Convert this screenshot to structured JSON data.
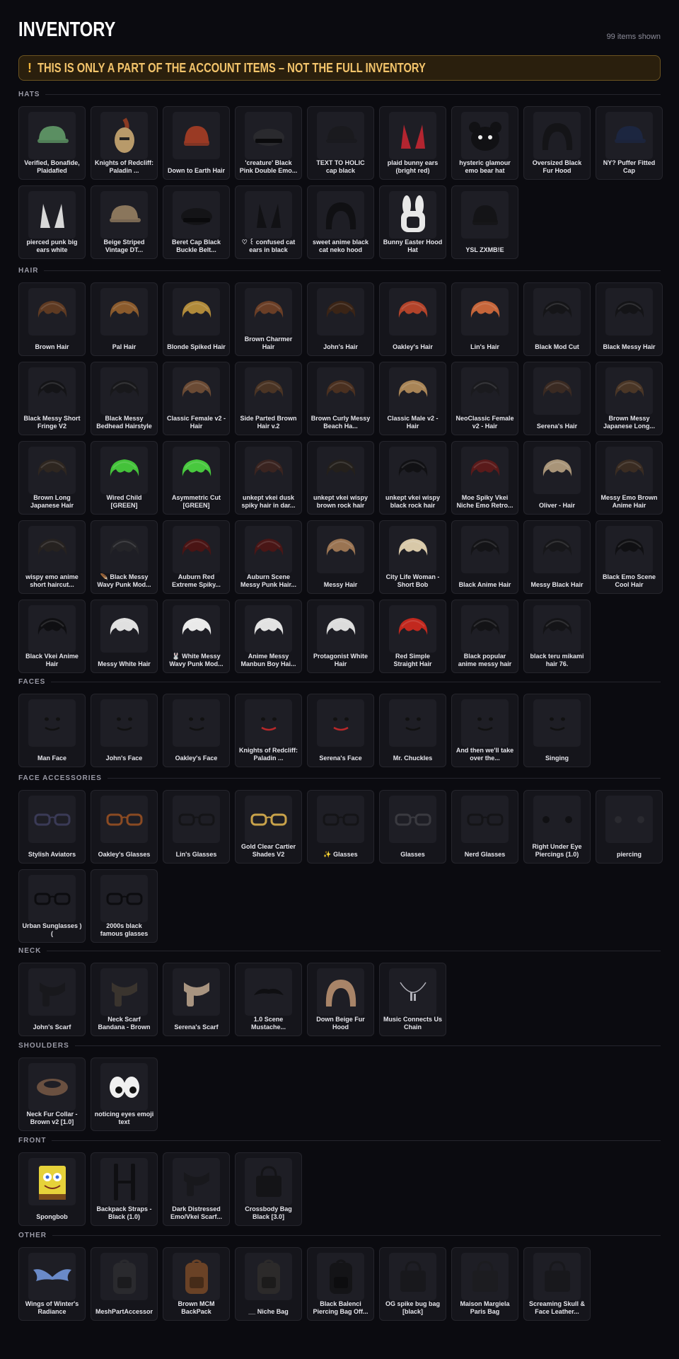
{
  "header": {
    "title": "INVENTORY",
    "count": "99 items shown"
  },
  "notice": {
    "icon": "!",
    "text": "THIS IS ONLY A PART OF THE ACCOUNT ITEMS – NOT THE FULL INVENTORY"
  },
  "sections": [
    {
      "title": "HATS",
      "items": [
        {
          "name": "Verified, Bonafide, Plaidafied",
          "icon": "cap-icon",
          "color": "#5b8f62"
        },
        {
          "name": "Knights of Redcliff: Paladin ...",
          "icon": "helmet-icon",
          "color": "#8a3a22"
        },
        {
          "name": "Down to Earth Hair",
          "icon": "beanie-icon",
          "color": "#9a3a24"
        },
        {
          "name": "'creature' Black Pink Double Emo...",
          "icon": "hat-icon",
          "color": "#2a2a2e"
        },
        {
          "name": "TEXT TO HOLIC cap black",
          "icon": "cap-icon",
          "color": "#1a1a1e"
        },
        {
          "name": "plaid bunny ears (bright red)",
          "icon": "ears-icon",
          "color": "#b32530"
        },
        {
          "name": "hysteric glamour emo bear hat",
          "icon": "bear-hat-icon",
          "color": "#111114"
        },
        {
          "name": "Oversized Black Fur Hood",
          "icon": "hood-icon",
          "color": "#141417"
        },
        {
          "name": "NY? Puffer Fitted Cap",
          "icon": "cap-icon",
          "color": "#1c2640"
        },
        {
          "name": "pierced punk big ears white",
          "icon": "ears-icon",
          "color": "#d8d8d8"
        },
        {
          "name": "Beige Striped Vintage DT...",
          "icon": "cap-icon",
          "color": "#8a765c"
        },
        {
          "name": "Beret Cap Black Buckle Belt...",
          "icon": "beret-icon",
          "color": "#141417"
        },
        {
          "name": "♡ ꒰ confused cat ears in black",
          "icon": "cat-ears-icon",
          "color": "#111114"
        },
        {
          "name": "sweet anime black cat neko hood",
          "icon": "hood-icon",
          "color": "#101013"
        },
        {
          "name": "Bunny Easter Hood Hat",
          "icon": "bunny-hood-icon",
          "color": "#e8e8e8"
        },
        {
          "name": "YSL ZXMB!E",
          "icon": "beanie-icon",
          "color": "#141417"
        }
      ]
    },
    {
      "title": "HAIR",
      "items": [
        {
          "name": "Brown Hair",
          "icon": "hair-icon",
          "color": "#5e3a22"
        },
        {
          "name": "Pal Hair",
          "icon": "hair-icon",
          "color": "#8a5a2c"
        },
        {
          "name": "Blonde Spiked Hair",
          "icon": "hair-icon",
          "color": "#b08a3a"
        },
        {
          "name": "Brown Charmer Hair",
          "icon": "hair-icon",
          "color": "#6a3e26"
        },
        {
          "name": "John's Hair",
          "icon": "hair-icon",
          "color": "#3a2416"
        },
        {
          "name": "Oakley's Hair",
          "icon": "hair-icon",
          "color": "#b2432a"
        },
        {
          "name": "Lin's Hair",
          "icon": "hair-icon",
          "color": "#c5653a"
        },
        {
          "name": "Black Mod Cut",
          "icon": "hair-icon",
          "color": "#151518"
        },
        {
          "name": "Black Messy Hair",
          "icon": "hair-icon",
          "color": "#141417"
        },
        {
          "name": "Black Messy Short Fringe V2",
          "icon": "hair-icon",
          "color": "#141417"
        },
        {
          "name": "Black Messy Bedhead Hairstyle",
          "icon": "hair-icon",
          "color": "#18181b"
        },
        {
          "name": "Classic Female v2 - Hair",
          "icon": "hair-icon",
          "color": "#6a4a34"
        },
        {
          "name": "Side Parted Brown Hair v.2",
          "icon": "hair-icon",
          "color": "#4a3424"
        },
        {
          "name": "Brown Curly Messy Beach Ha...",
          "icon": "hair-icon",
          "color": "#4a3020"
        },
        {
          "name": "Classic Male v2 - Hair",
          "icon": "hair-icon",
          "color": "#a88456"
        },
        {
          "name": "NeoClassic Female v2 - Hair",
          "icon": "hair-icon",
          "color": "#1a1a1e"
        },
        {
          "name": "Serena's Hair",
          "icon": "hair-icon",
          "color": "#3a2a22"
        },
        {
          "name": "Brown Messy Japanese Long...",
          "icon": "hair-icon",
          "color": "#4a3626"
        },
        {
          "name": "Brown Long Japanese Hair",
          "icon": "hair-icon",
          "color": "#2e2620"
        },
        {
          "name": "Wired Child [GREEN]",
          "icon": "hair-icon",
          "color": "#44c23a"
        },
        {
          "name": "Asymmetric Cut [GREEN]",
          "icon": "hair-icon",
          "color": "#48c83e"
        },
        {
          "name": "unkept vkei dusk spiky hair in dar...",
          "icon": "hair-icon",
          "color": "#3a2420"
        },
        {
          "name": "unkept vkei wispy brown rock hair",
          "icon": "hair-icon",
          "color": "#24201c"
        },
        {
          "name": "unkept vkei wispy black rock hair",
          "icon": "hair-icon",
          "color": "#111114"
        },
        {
          "name": "Moe Spiky Vkei Niche Emo Retro...",
          "icon": "hair-icon",
          "color": "#5a1a1a"
        },
        {
          "name": "Oliver - Hair",
          "icon": "hair-icon",
          "color": "#a89478"
        },
        {
          "name": "Messy Emo Brown Anime Hair",
          "icon": "hair-icon",
          "color": "#3a2c22"
        },
        {
          "name": "wispy emo anime short haircut...",
          "icon": "hair-icon",
          "color": "#262220"
        },
        {
          "name": "🪶 Black Messy Wavy Punk Mod...",
          "icon": "hair-icon",
          "color": "#242428"
        },
        {
          "name": "Auburn Red Extreme Spiky...",
          "icon": "hair-icon",
          "color": "#4a1414"
        },
        {
          "name": "Auburn Scene Messy Punk Hair...",
          "icon": "hair-icon",
          "color": "#4a1616"
        },
        {
          "name": "Messy Hair",
          "icon": "hair-icon",
          "color": "#9a7452"
        },
        {
          "name": "City Life Woman - Short Bob",
          "icon": "hair-icon",
          "color": "#d8c8a8"
        },
        {
          "name": "Black Anime Hair",
          "icon": "hair-icon",
          "color": "#141417"
        },
        {
          "name": "Messy Black Hair",
          "icon": "hair-icon",
          "color": "#17171a"
        },
        {
          "name": "Black Emo Scene Cool Hair",
          "icon": "hair-icon",
          "color": "#101013"
        },
        {
          "name": "Black Vkei Anime Hair",
          "icon": "hair-icon",
          "color": "#0f0f12"
        },
        {
          "name": "Messy White Hair",
          "icon": "hair-icon",
          "color": "#e0e0e0"
        },
        {
          "name": "🐰 White Messy Wavy Punk Mod...",
          "icon": "hair-icon",
          "color": "#eaeaea"
        },
        {
          "name": "Anime Messy Manbun Boy Hai...",
          "icon": "hair-icon",
          "color": "#e2e2e2"
        },
        {
          "name": "Protagonist White Hair",
          "icon": "hair-icon",
          "color": "#dcdcdc"
        },
        {
          "name": "Red Simple Straight Hair",
          "icon": "hair-icon",
          "color": "#c2281e"
        },
        {
          "name": "Black popular anime messy hair",
          "icon": "hair-icon",
          "color": "#131316"
        },
        {
          "name": "black teru mikami hair 76.",
          "icon": "hair-icon",
          "color": "#141417"
        }
      ]
    },
    {
      "title": "FACES",
      "items": [
        {
          "name": "Man Face",
          "icon": "face-icon",
          "color": "#111"
        },
        {
          "name": "John's Face",
          "icon": "face-icon",
          "color": "#111"
        },
        {
          "name": "Oakley's Face",
          "icon": "face-icon",
          "color": "#111"
        },
        {
          "name": "Knights of Redcliff: Paladin ...",
          "icon": "face-icon",
          "color": "#b8282a"
        },
        {
          "name": "Serena's Face",
          "icon": "face-icon",
          "color": "#b8282a"
        },
        {
          "name": "Mr. Chuckles",
          "icon": "face-icon",
          "color": "#111"
        },
        {
          "name": "And then we'll take over the...",
          "icon": "face-icon",
          "color": "#111"
        },
        {
          "name": "Singing",
          "icon": "face-icon",
          "color": "#111"
        }
      ]
    },
    {
      "title": "FACE ACCESSORIES",
      "items": [
        {
          "name": "Stylish Aviators",
          "icon": "glasses-icon",
          "color": "#3a3a56"
        },
        {
          "name": "Oakley's Glasses",
          "icon": "glasses-icon",
          "color": "#8a4a22"
        },
        {
          "name": "Lin's Glasses",
          "icon": "glasses-icon",
          "color": "#141417"
        },
        {
          "name": "Gold Clear Cartier Shades V2",
          "icon": "glasses-icon",
          "color": "#c8a24a"
        },
        {
          "name": "✨ Glasses",
          "icon": "glasses-icon",
          "color": "#141417"
        },
        {
          "name": "Glasses",
          "icon": "glasses-icon",
          "color": "#3a3a40"
        },
        {
          "name": "Nerd Glasses",
          "icon": "glasses-icon",
          "color": "#141417"
        },
        {
          "name": "Right Under Eye Piercings (1.0)",
          "icon": "piercing-icon",
          "color": "#101013"
        },
        {
          "name": "piercing",
          "icon": "piercing-icon",
          "color": "#2a2a30"
        },
        {
          "name": "Urban Sunglasses )(",
          "icon": "glasses-icon",
          "color": "#0c0c0f"
        },
        {
          "name": "2000s black famous glasses",
          "icon": "glasses-icon",
          "color": "#0c0c0f"
        }
      ]
    },
    {
      "title": "NECK",
      "items": [
        {
          "name": "John's Scarf",
          "icon": "scarf-icon",
          "color": "#18181c"
        },
        {
          "name": "Neck Scarf Bandana - Brown",
          "icon": "scarf-icon",
          "color": "#3a342e"
        },
        {
          "name": "Serena's Scarf",
          "icon": "scarf-icon",
          "color": "#a89480"
        },
        {
          "name": "1.0 Scene Mustache...",
          "icon": "mustache-icon",
          "color": "#0f0f12"
        },
        {
          "name": "Down Beige Fur Hood",
          "icon": "hood-icon",
          "color": "#a88468"
        },
        {
          "name": "Music Connects Us Chain",
          "icon": "chain-icon",
          "color": "#b0b0b8"
        }
      ]
    },
    {
      "title": "SHOULDERS",
      "items": [
        {
          "name": "Neck Fur Collar - Brown v2 [1.0]",
          "icon": "collar-icon",
          "color": "#6a5040"
        },
        {
          "name": "noticing eyes emoji text",
          "icon": "eyes-icon",
          "color": "#f0f0f0"
        }
      ]
    },
    {
      "title": "FRONT",
      "items": [
        {
          "name": "Spongbob",
          "icon": "spongebob-icon",
          "color": "#e6d23a"
        },
        {
          "name": "Backpack Straps - Black (1.0)",
          "icon": "straps-icon",
          "color": "#0f0f12"
        },
        {
          "name": "Dark Distressed Emo/Vkei Scarf...",
          "icon": "scarf-icon",
          "color": "#18181c"
        },
        {
          "name": "Crossbody Bag Black [3.0]",
          "icon": "bag-icon",
          "color": "#141417"
        }
      ]
    },
    {
      "title": "OTHER",
      "items": [
        {
          "name": "Wings of Winter's Radiance",
          "icon": "wings-icon",
          "color": "#6a8ac8"
        },
        {
          "name": "MeshPartAccessor",
          "icon": "backpack-icon",
          "color": "#2a2a2e"
        },
        {
          "name": "Brown MCM BackPack",
          "icon": "backpack-icon",
          "color": "#6a4226"
        },
        {
          "name": "__ Niche Bag",
          "icon": "backpack-icon",
          "color": "#2c2a2a"
        },
        {
          "name": "Black Balenci Piercing Bag Off...",
          "icon": "backpack-icon",
          "color": "#141417"
        },
        {
          "name": "OG spike bug bag [black]",
          "icon": "bag-icon",
          "color": "#18181c"
        },
        {
          "name": "Maison Margiela Paris Bag",
          "icon": "bag-icon",
          "color": "#1c1c20"
        },
        {
          "name": "Screaming Skull & Face Leather...",
          "icon": "bag-icon",
          "color": "#18181c"
        }
      ]
    }
  ]
}
